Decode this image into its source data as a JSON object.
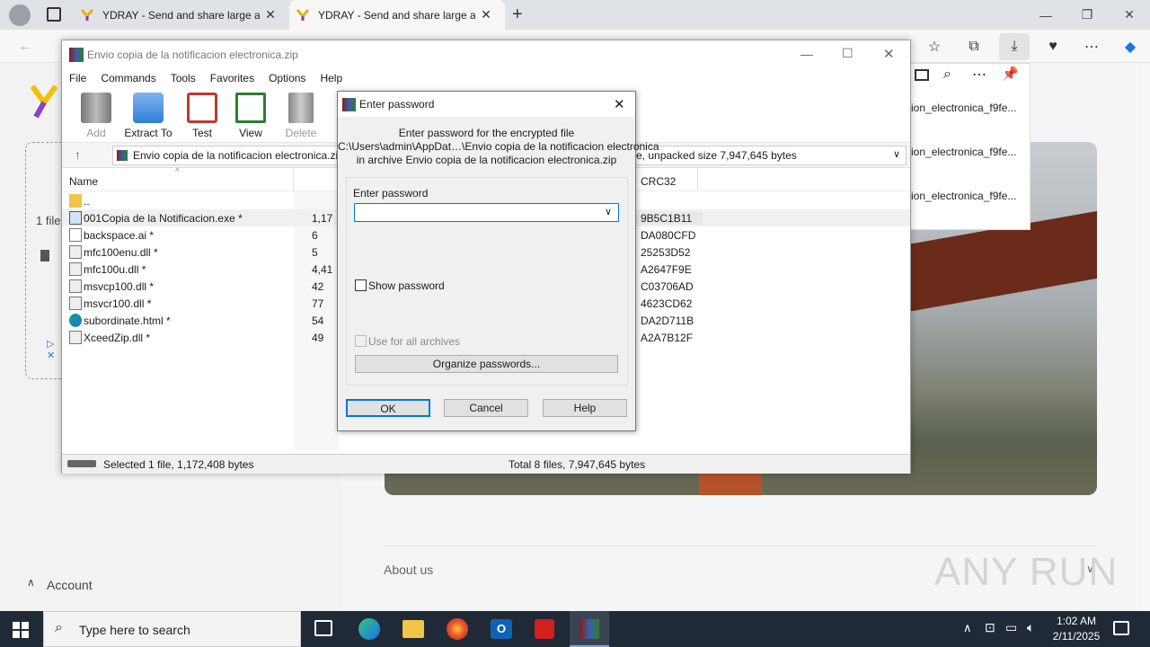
{
  "browser": {
    "tabs": [
      {
        "title": "YDRAY - Send and share large an"
      },
      {
        "title": "YDRAY - Send and share large an"
      }
    ]
  },
  "page": {
    "about": "About us",
    "account": "Account",
    "files_count": "1 file",
    "watermark": "ANY RUN"
  },
  "downloads": {
    "items": [
      "ion_electronica_f9fe...",
      "ion_electronica_f9fe...",
      "ion_electronica_f9fe..."
    ]
  },
  "winrar": {
    "title": "Envio copia de la notificacion electronica.zip",
    "menu": [
      "File",
      "Commands",
      "Tools",
      "Favorites",
      "Options",
      "Help"
    ],
    "toolbar": [
      "Add",
      "Extract To",
      "Test",
      "View",
      "Delete"
    ],
    "path": "Envio copia de la notificacion electronica.zi",
    "path_info": "e, unpacked size 7,947,645 bytes",
    "columns": {
      "name": "Name",
      "crc": "CRC32"
    },
    "files": [
      {
        "name": "..",
        "size": "",
        "crc": ""
      },
      {
        "name": "001Copia de la Notificacion.exe *",
        "size": "1,17",
        "crc": "9B5C1B11"
      },
      {
        "name": "backspace.ai *",
        "size": "6",
        "crc": "DA080CFD"
      },
      {
        "name": "mfc100enu.dll *",
        "size": "5",
        "crc": "25253D52"
      },
      {
        "name": "mfc100u.dll *",
        "size": "4,41",
        "crc": "A2647F9E"
      },
      {
        "name": "msvcp100.dll *",
        "size": "42",
        "crc": "C03706AD"
      },
      {
        "name": "msvcr100.dll *",
        "size": "77",
        "crc": "4623CD62"
      },
      {
        "name": "subordinate.html *",
        "size": "54",
        "crc": "DA2D711B"
      },
      {
        "name": "XceedZip.dll *",
        "size": "49",
        "crc": "A2A7B12F"
      }
    ],
    "status_left": "Selected 1 file, 1,172,408 bytes",
    "status_right": "Total 8 files, 7,947,645 bytes"
  },
  "dialog": {
    "title": "Enter password",
    "line1": "Enter password for the encrypted file",
    "line2": "C:\\Users\\admin\\AppDat…\\Envio copia de la notificacion electronica",
    "line3": "in archive Envio copia de la notificacion electronica.zip",
    "group_label": "Enter password",
    "password_value": "",
    "show_password": "Show password",
    "use_for_all": "Use for all archives",
    "organize": "Organize passwords...",
    "ok": "OK",
    "cancel": "Cancel",
    "help": "Help"
  },
  "taskbar": {
    "search_placeholder": "Type here to search",
    "time": "1:02 AM",
    "date": "2/11/2025"
  }
}
